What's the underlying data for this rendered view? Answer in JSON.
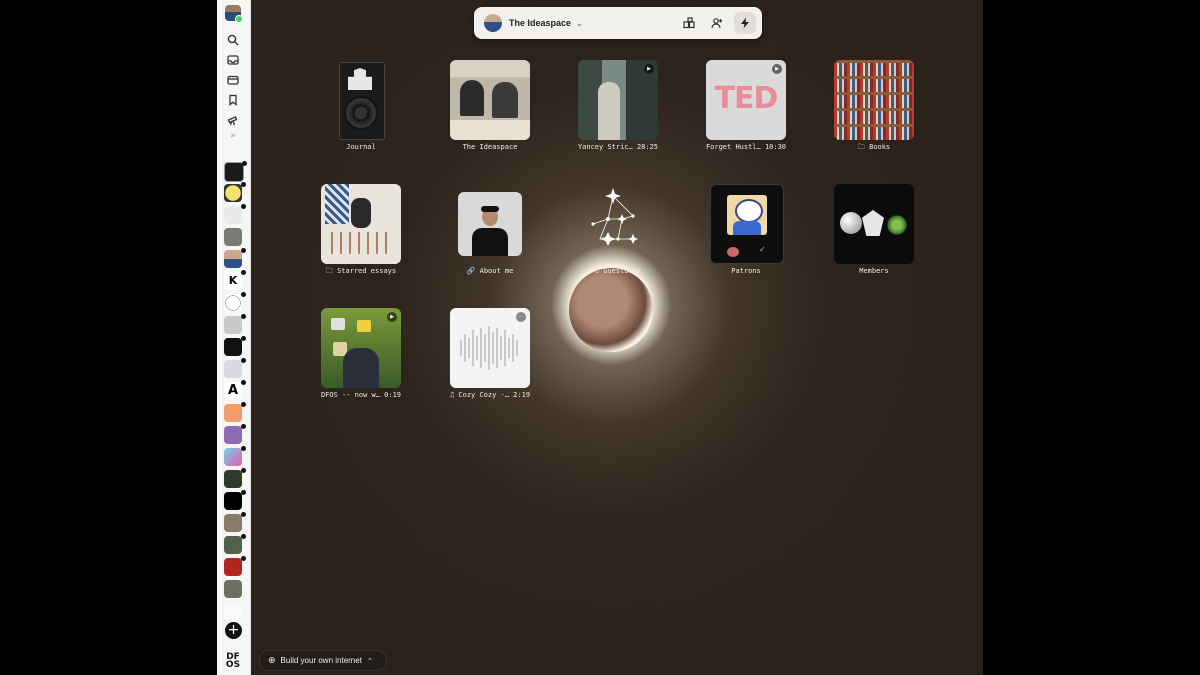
{
  "topbar": {
    "space_title": "The Ideaspace"
  },
  "tiles": [
    {
      "label": "Journal",
      "kind": "object"
    },
    {
      "label": "The Ideaspace",
      "kind": "photo"
    },
    {
      "label": "Yancey Stric… 28:25",
      "kind": "video"
    },
    {
      "label": "Forget Hustl… 10:30",
      "kind": "video"
    },
    {
      "label": "Books",
      "kind": "folder"
    },
    {
      "label": "Starred essays",
      "kind": "folder"
    },
    {
      "label": "About me",
      "kind": "link"
    },
    {
      "label": "Guestbook",
      "kind": "guestbook"
    },
    {
      "label": "Patrons",
      "kind": "patrons"
    },
    {
      "label": "Members",
      "kind": "members"
    },
    {
      "label": "DFOS -- now w… 0:19",
      "kind": "video"
    },
    {
      "label": "Cozy Cozy -… 2:19",
      "kind": "audio"
    }
  ],
  "bottom_bar": {
    "label": "Build your own internet"
  },
  "sidebar": {
    "logo_text": "DF OS"
  },
  "colors": {
    "canvas": "#2a221b",
    "sidebar": "#f6f6f6",
    "topbar": "#f3f1ee"
  }
}
